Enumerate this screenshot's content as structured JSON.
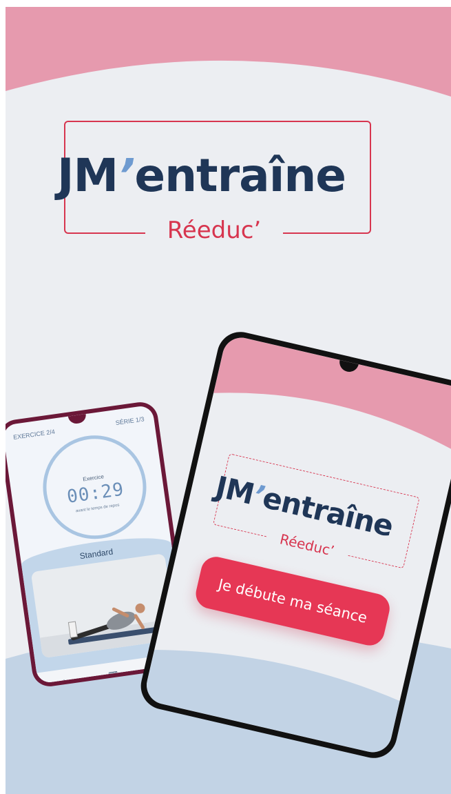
{
  "brand": {
    "name_part1": "JM",
    "apostrophe": "’",
    "name_part2": "entraîne",
    "subtitle": "Réeduc’"
  },
  "colors": {
    "background": "#eceef2",
    "pink_wave": "#e69aae",
    "blue_wave": "#c2d3e5",
    "navy": "#1f3657",
    "accent_red": "#d7354f",
    "button_red": "#e63755",
    "light_blue": "#6e9ad0"
  },
  "left_phone": {
    "exercise_counter": "EXERCICE 2/4",
    "set_counter": "SÉRIE 1/3",
    "timer_label": "Exercice",
    "timer_value": "00:29",
    "timer_caption": "avant le temps de repos",
    "level_label": "Standard",
    "tab_icons": [
      "home-icon",
      "library-icon",
      "progress-icon"
    ]
  },
  "right_phone": {
    "cta_label": "Je débute ma séance"
  }
}
